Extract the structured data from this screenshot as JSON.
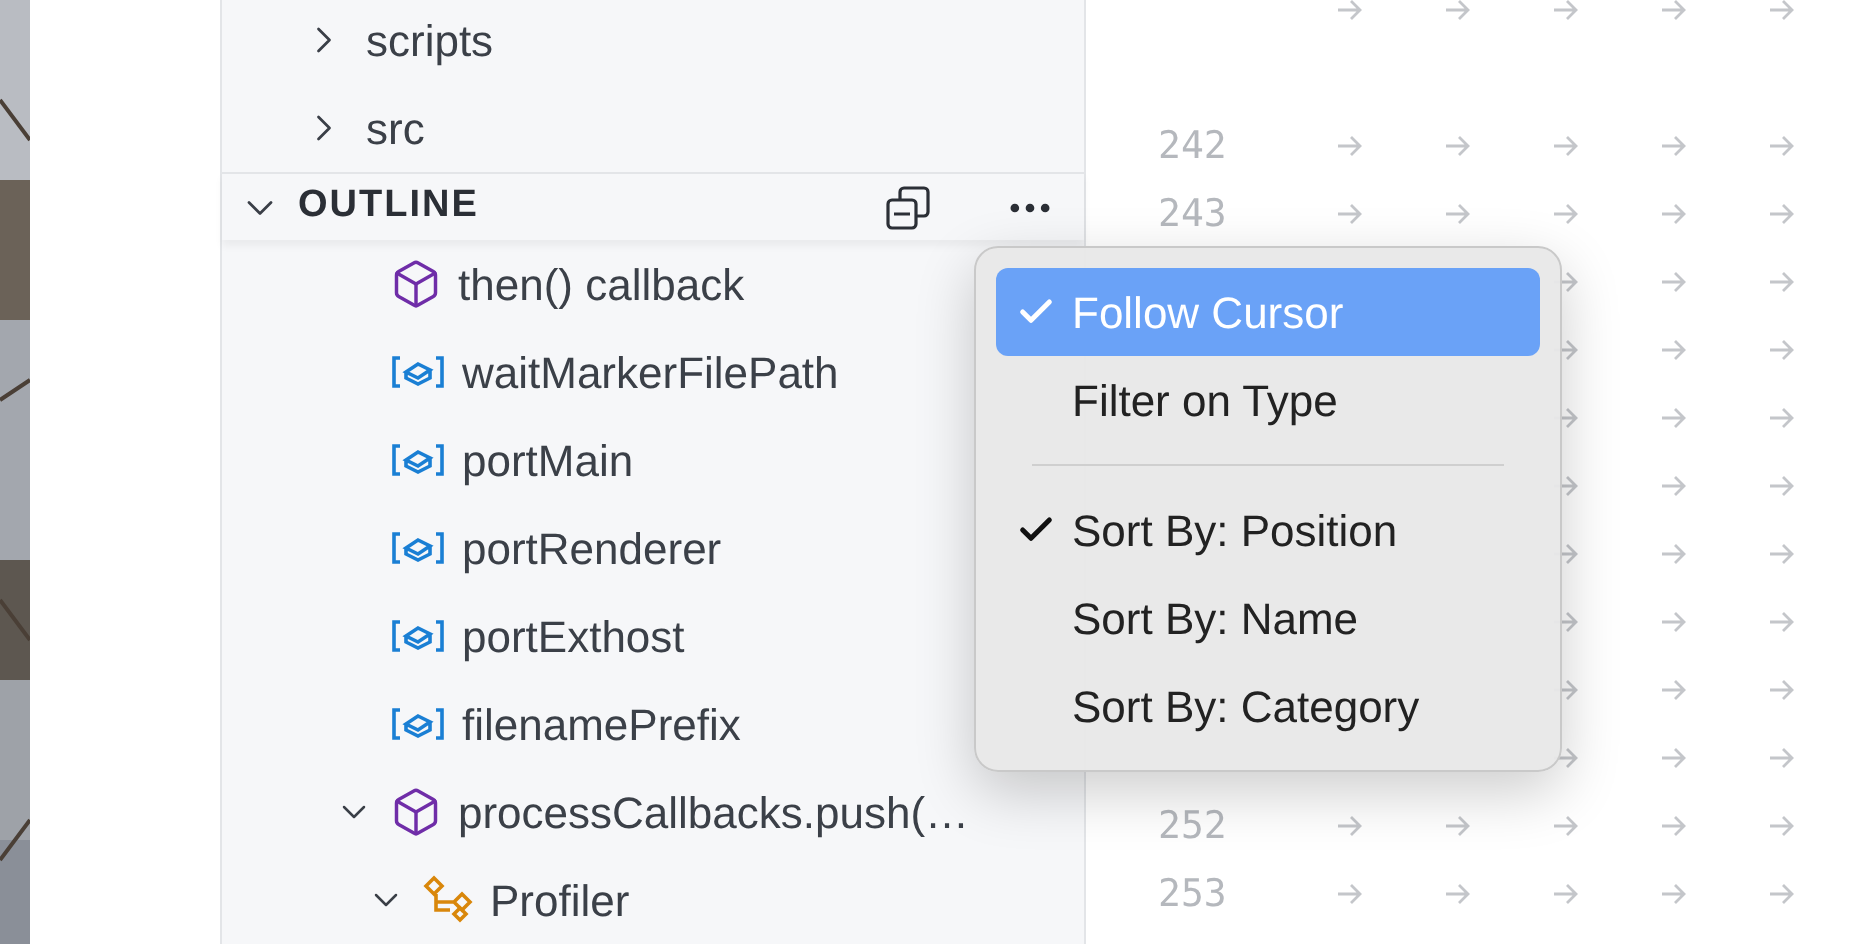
{
  "explorer": {
    "folders": [
      {
        "label": "scripts",
        "expanded": false
      },
      {
        "label": "src",
        "expanded": false
      }
    ]
  },
  "outline": {
    "title": "OUTLINE",
    "expanded": true,
    "items": [
      {
        "children": [
          {
            "label": "then() callback",
            "kind": "object"
          }
        ]
      },
      {
        "label": "waitMarkerFilePath",
        "kind": "variable"
      },
      {
        "label": "portMain",
        "kind": "variable"
      },
      {
        "label": "portRenderer",
        "kind": "variable"
      },
      {
        "label": "portExthost",
        "kind": "variable"
      },
      {
        "label": "filenamePrefix",
        "kind": "variable"
      },
      {
        "label": "processCallbacks.push(…",
        "kind": "object",
        "expanded": true,
        "children": [
          {
            "label": "Profiler",
            "kind": "class",
            "expanded": true
          }
        ]
      }
    ]
  },
  "menu": {
    "items": [
      {
        "label": "Follow Cursor",
        "checked": true,
        "selected": true
      },
      {
        "label": "Filter on Type",
        "checked": false,
        "selected": false
      },
      {
        "kind": "separator"
      },
      {
        "label": "Sort By: Position",
        "checked": true,
        "selected": false
      },
      {
        "label": "Sort By: Name",
        "checked": false,
        "selected": false
      },
      {
        "label": "Sort By: Category",
        "checked": false,
        "selected": false
      }
    ]
  },
  "editor": {
    "lines": [
      {
        "kind": "cut"
      },
      {
        "kind": "wrap"
      },
      {
        "number": "242"
      },
      {
        "number": "243"
      },
      {
        "kind": "covered"
      },
      {
        "kind": "covered"
      },
      {
        "kind": "covered"
      },
      {
        "kind": "covered"
      },
      {
        "kind": "covered"
      },
      {
        "kind": "covered"
      },
      {
        "kind": "covered"
      },
      {
        "kind": "covered"
      },
      {
        "number": "252"
      },
      {
        "number": "253"
      }
    ]
  }
}
